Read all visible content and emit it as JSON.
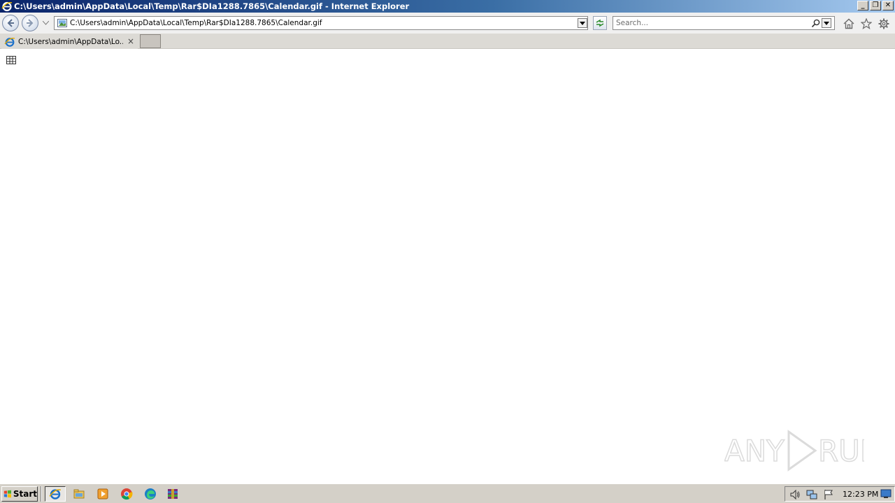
{
  "window": {
    "title": "C:\\Users\\admin\\AppData\\Local\\Temp\\Rar$DIa1288.7865\\Calendar.gif - Internet Explorer",
    "controls": {
      "minimize": "_",
      "restore": "❐",
      "close": "✕"
    }
  },
  "toolbar": {
    "address": "C:\\Users\\admin\\AppData\\Local\\Temp\\Rar$DIa1288.7865\\Calendar.gif",
    "search_placeholder": "Search...",
    "icons": [
      "back-icon",
      "forward-icon",
      "refresh-icon",
      "search-icon",
      "home-icon",
      "favorites-star-icon",
      "tools-gear-icon"
    ]
  },
  "tabs": [
    {
      "label": "C:\\Users\\admin\\AppData\\Lo...",
      "close": "×"
    }
  ],
  "content": {
    "image_state": "broken-image-placeholder"
  },
  "taskbar": {
    "start_label": "Start",
    "pinned": [
      "internet-explorer-icon",
      "file-explorer-icon",
      "media-player-icon",
      "chrome-icon",
      "edge-icon",
      "winrar-icon"
    ],
    "clock": "12:23 PM"
  },
  "watermark": {
    "text": "ANY RUN"
  },
  "colors": {
    "titlebar_start": "#0a246a",
    "titlebar_end": "#a6caf0",
    "chrome": "#f0f0f0",
    "taskbar": "#d4d0c8"
  }
}
